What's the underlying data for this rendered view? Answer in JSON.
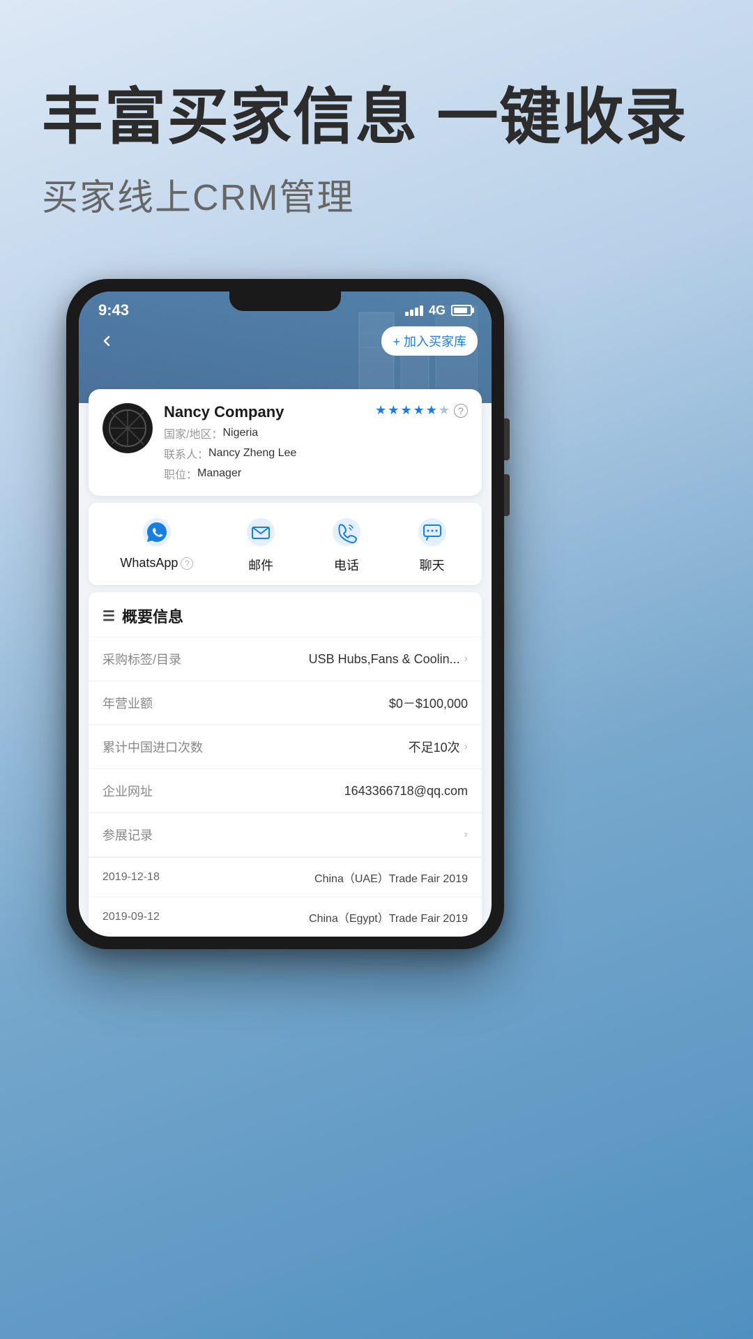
{
  "page": {
    "headline": "丰富买家信息 一键收录",
    "subtitle": "买家线上CRM管理"
  },
  "phone": {
    "status_time": "9:43",
    "status_4g": "4G",
    "nav_back": "‹",
    "nav_action_label": "+ 加入买家库",
    "company_name": "Nancy Company",
    "country_label": "国家/地区：",
    "country_value": "Nigeria",
    "contact_label": "联系人：",
    "contact_value": "Nancy Zheng Lee",
    "position_label": "职位：",
    "position_value": "Manager",
    "stars_count": 5,
    "stars_half": false,
    "actions": [
      {
        "id": "whatsapp",
        "label": "WhatsApp",
        "has_help": true
      },
      {
        "id": "email",
        "label": "邮件",
        "has_help": false
      },
      {
        "id": "phone",
        "label": "电话",
        "has_help": false
      },
      {
        "id": "chat",
        "label": "聊天",
        "has_help": false
      }
    ],
    "overview_title": "概要信息",
    "info_rows": [
      {
        "label": "采购标签/目录",
        "value": "USB Hubs,Fans & Coolin...",
        "has_arrow": true
      },
      {
        "label": "年营业额",
        "value": "$0－$100,000",
        "has_arrow": false
      },
      {
        "label": "累计中国进口次数",
        "value": "不足10次",
        "has_arrow": true
      },
      {
        "label": "企业网址",
        "value": "1643366718@qq.com",
        "has_arrow": false
      },
      {
        "label": "参展记录",
        "value": "",
        "has_arrow": true
      }
    ],
    "exhibit_rows": [
      {
        "date": "2019-12-18",
        "name": "China（UAE）Trade Fair 2019"
      },
      {
        "date": "2019-09-12",
        "name": "China（Egypt）Trade Fair 2019"
      }
    ]
  }
}
